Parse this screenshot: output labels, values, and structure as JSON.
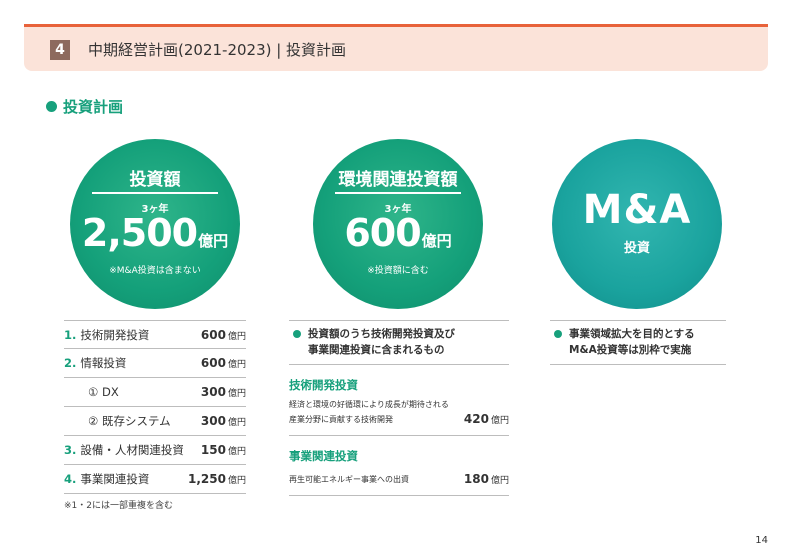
{
  "header": {
    "section_number": "4",
    "title": "中期経営計画(2021-2023) | 投資計画"
  },
  "subheading": "投資計画",
  "circles": {
    "investment": {
      "title": "投資額",
      "period": "3ヶ年",
      "amount": "2,500",
      "unit": "億円",
      "note": "※M&A投資は含まない"
    },
    "environment": {
      "title": "環境関連投資額",
      "period": "3ヶ年",
      "amount": "600",
      "unit": "億円",
      "note": "※投資額に含む"
    },
    "mna": {
      "title": "M&A",
      "subtitle": "投資"
    }
  },
  "investment_list": [
    {
      "index": "1.",
      "label": "技術開発投資",
      "value": "600",
      "unit": "億円"
    },
    {
      "index": "2.",
      "label": "情報投資",
      "value": "600",
      "unit": "億円"
    },
    {
      "index": "",
      "label": "① DX",
      "value": "300",
      "unit": "億円"
    },
    {
      "index": "",
      "label": "② 既存システム",
      "value": "300",
      "unit": "億円"
    },
    {
      "index": "3.",
      "label": "設備・人材関連投資",
      "value": "150",
      "unit": "億円"
    },
    {
      "index": "4.",
      "label": "事業関連投資",
      "value": "1,250",
      "unit": "億円"
    }
  ],
  "investment_footnote": "※1・2には一部重複を含む",
  "environment_detail": {
    "bullet_line1": "投資額のうち技術開発投資及び",
    "bullet_line2": "事業関連投資に含まれるもの",
    "categories": [
      {
        "title": "技術開発投資",
        "desc_line1": "経済と環境の好循環により成長が期待される",
        "desc_line2": "産業分野に貢献する技術開発",
        "value": "420",
        "unit": "億円"
      },
      {
        "title": "事業関連投資",
        "desc_line1": "再生可能エネルギー事業への出資",
        "desc_line2": "",
        "value": "180",
        "unit": "億円"
      }
    ]
  },
  "mna_detail": {
    "bullet_line1": "事業領域拡大を目的とする",
    "bullet_line2": "M&A投資等は別枠で実施"
  },
  "page_number": "14",
  "colors": {
    "accent_green": "#17a07c",
    "header_line": "#e8623a",
    "header_band": "#fbe3d9",
    "circle_teal": "#1aa39e",
    "section_badge": "#8d6a5e"
  }
}
